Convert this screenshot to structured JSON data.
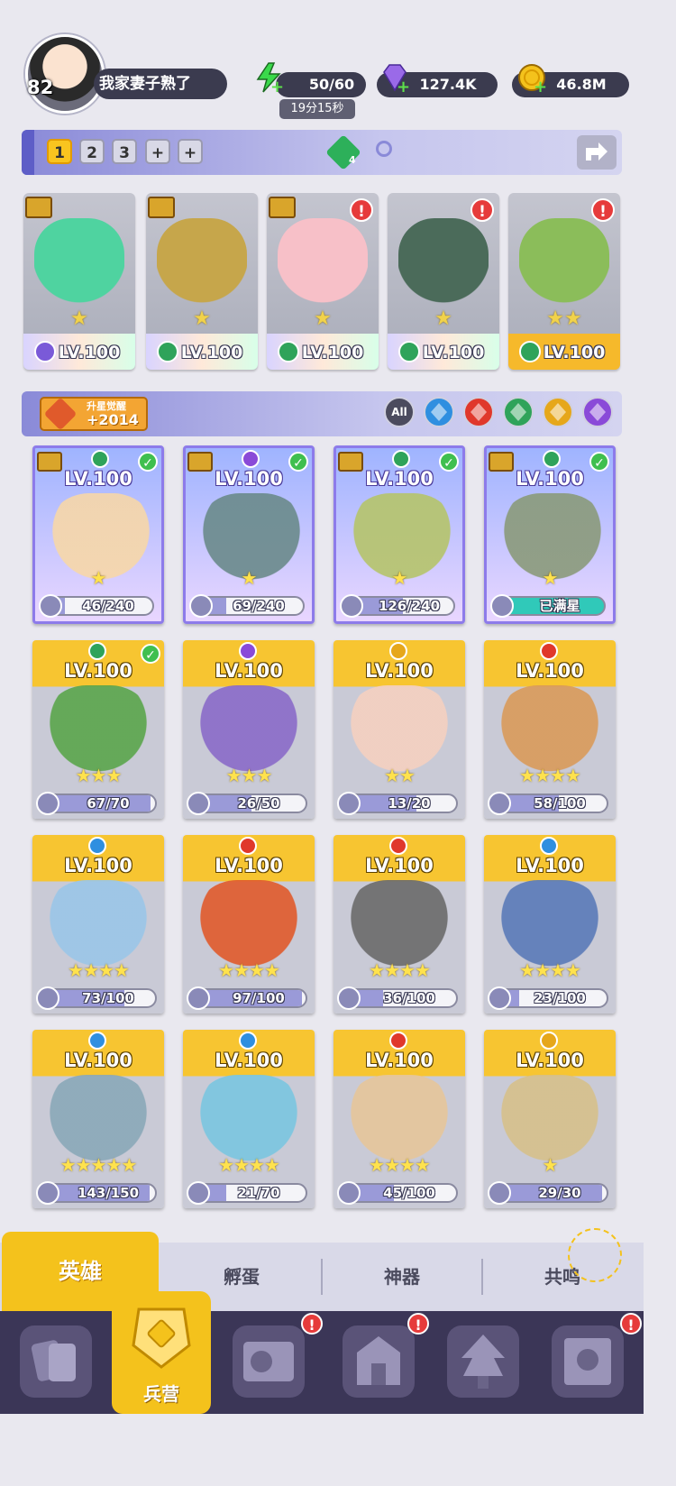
{
  "player": {
    "level": "82",
    "name": "我家妻子熟了"
  },
  "resources": {
    "energy": {
      "icon": "lightning-icon",
      "value": "50/60",
      "timer": "19分15秒"
    },
    "gems": {
      "icon": "diamond-icon",
      "value": "127.4K"
    },
    "gold": {
      "icon": "gold-coin-icon",
      "value": "46.8M"
    }
  },
  "formation": {
    "tabs": [
      "1",
      "2",
      "3",
      "+",
      "+"
    ],
    "active_tab": "1",
    "gem_count": "4"
  },
  "team": [
    {
      "level": "LV.100",
      "element": "dark",
      "color": "#7a5ad8",
      "art": "#4fd3a0",
      "stars": "★",
      "alert": false,
      "bar": "rainbow"
    },
    {
      "level": "LV.100",
      "element": "nature",
      "color": "#2fa35a",
      "art": "#c6a64b",
      "stars": "★",
      "alert": false,
      "bar": "rainbow"
    },
    {
      "level": "LV.100",
      "element": "nature",
      "color": "#2fa35a",
      "art": "#f7c0c8",
      "stars": "★",
      "alert": true,
      "bar": "rainbow"
    },
    {
      "level": "LV.100",
      "element": "nature",
      "color": "#2fa35a",
      "art": "#4b6b5a",
      "stars": "★",
      "alert": true,
      "bar": "rainbow"
    },
    {
      "level": "LV.100",
      "element": "nature",
      "color": "#2fa35a",
      "art": "#8bbd5a",
      "stars": "★★",
      "alert": true,
      "bar": "gold"
    }
  ],
  "awaken": {
    "label": "升星觉醒",
    "value": "+2014"
  },
  "filters": [
    {
      "label": "All",
      "color": "#4b4b5e"
    },
    {
      "label": "",
      "color": "#2f8fe0"
    },
    {
      "label": "",
      "color": "#e0382b"
    },
    {
      "label": "",
      "color": "#2fa35a"
    },
    {
      "label": "",
      "color": "#e6a71a"
    },
    {
      "label": "",
      "color": "#8a4ad8"
    }
  ],
  "heroes": [
    {
      "level": "LV.100",
      "style": "purple",
      "element_color": "#2fa35a",
      "crest": true,
      "check": true,
      "stars": "★",
      "progress": "46/240",
      "pct": 19,
      "art": "#f7d7a8"
    },
    {
      "level": "LV.100",
      "style": "purple",
      "element_color": "#8a4ad8",
      "crest": true,
      "check": true,
      "stars": "★",
      "progress": "69/240",
      "pct": 29,
      "art": "#6a8a8a"
    },
    {
      "level": "LV.100",
      "style": "purple",
      "element_color": "#2fa35a",
      "crest": true,
      "check": true,
      "stars": "★",
      "progress": "126/240",
      "pct": 53,
      "art": "#b5c46a"
    },
    {
      "level": "LV.100",
      "style": "purple",
      "element_color": "#2fa35a",
      "crest": true,
      "check": true,
      "stars": "★",
      "progress": "已满星",
      "pct": 100,
      "art": "#8a9a7a",
      "full": true
    },
    {
      "level": "LV.100",
      "style": "gold",
      "element_color": "#2fa35a",
      "crest": false,
      "check": true,
      "stars": "★★★",
      "progress": "67/70",
      "pct": 96,
      "art": "#5aa54b"
    },
    {
      "level": "LV.100",
      "style": "gold",
      "element_color": "#8a4ad8",
      "crest": false,
      "check": false,
      "stars": "★★★",
      "progress": "26/50",
      "pct": 52,
      "art": "#8a6ac8"
    },
    {
      "level": "LV.100",
      "style": "gold",
      "element_color": "#e6a71a",
      "crest": false,
      "check": false,
      "stars": "★★",
      "progress": "13/20",
      "pct": 65,
      "art": "#f5d0c0"
    },
    {
      "level": "LV.100",
      "style": "gold",
      "element_color": "#e0382b",
      "crest": false,
      "check": false,
      "stars": "★★★★",
      "progress": "58/100",
      "pct": 58,
      "art": "#d99a5a"
    },
    {
      "level": "LV.100",
      "style": "gold",
      "element_color": "#2f8fe0",
      "crest": false,
      "check": false,
      "stars": "★★★★",
      "progress": "73/100",
      "pct": 73,
      "art": "#9ac6e8"
    },
    {
      "level": "LV.100",
      "style": "gold",
      "element_color": "#e0382b",
      "crest": false,
      "check": false,
      "stars": "★★★★",
      "progress": "97/100",
      "pct": 97,
      "art": "#e05a2b"
    },
    {
      "level": "LV.100",
      "style": "gold",
      "element_color": "#e0382b",
      "crest": false,
      "check": false,
      "stars": "★★★★",
      "progress": "36/100",
      "pct": 36,
      "art": "#6a6a6a"
    },
    {
      "level": "LV.100",
      "style": "gold",
      "element_color": "#2f8fe0",
      "crest": false,
      "check": false,
      "stars": "★★★★",
      "progress": "23/100",
      "pct": 23,
      "art": "#5a7ab8"
    },
    {
      "level": "LV.100",
      "style": "gold",
      "element_color": "#2f8fe0",
      "crest": false,
      "check": false,
      "stars": "★★★★★",
      "progress": "143/150",
      "pct": 95,
      "art": "#8aa8b8"
    },
    {
      "level": "LV.100",
      "style": "gold",
      "element_color": "#2f8fe0",
      "crest": false,
      "check": false,
      "stars": "★★★★",
      "progress": "21/70",
      "pct": 30,
      "art": "#7ac6e0"
    },
    {
      "level": "LV.100",
      "style": "gold",
      "element_color": "#e0382b",
      "crest": false,
      "check": false,
      "stars": "★★★★",
      "progress": "45/100",
      "pct": 45,
      "art": "#e6c69a"
    },
    {
      "level": "LV.100",
      "style": "gold",
      "element_color": "#e6a71a",
      "crest": false,
      "check": false,
      "stars": "★",
      "progress": "29/30",
      "pct": 96,
      "art": "#d6c08a"
    }
  ],
  "subtabs": [
    "英雄",
    "孵蛋",
    "神器",
    "共鸣"
  ],
  "bottom_nav": {
    "items": [
      {
        "icon": "cards-icon",
        "alert": false
      },
      {
        "icon": "barracks-icon",
        "label": "兵营",
        "active": true
      },
      {
        "icon": "book-icon",
        "alert": true
      },
      {
        "icon": "shrine-icon",
        "alert": true
      },
      {
        "icon": "tree-icon",
        "alert": false
      },
      {
        "icon": "banner-icon",
        "alert": true
      }
    ],
    "active_label": "兵营",
    "alert_symbol": "!"
  }
}
